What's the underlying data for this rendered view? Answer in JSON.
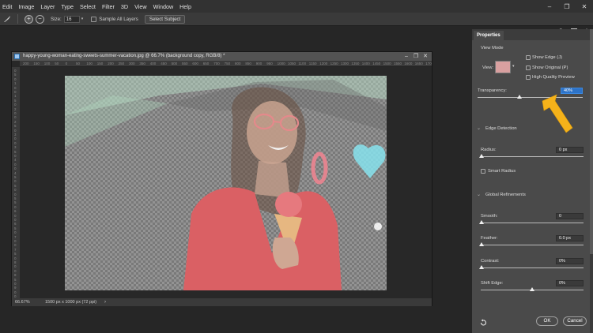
{
  "menu": [
    "Edit",
    "Image",
    "Layer",
    "Type",
    "Select",
    "Filter",
    "3D",
    "View",
    "Window",
    "Help"
  ],
  "window_controls": [
    "–",
    "❐",
    "✕"
  ],
  "options_bar": {
    "size_label": "Size:",
    "size_value": "16",
    "sample_all_layers_label": "Sample All Layers",
    "select_subject_label": "Select Subject"
  },
  "document": {
    "title": "happy-young-woman-eating-sweets-summer-vacation.jpg @ 66.7% (background copy, RGB/8) *",
    "ruler_top": [
      "200",
      "150",
      "100",
      "50",
      "0",
      "50",
      "100",
      "150",
      "200",
      "250",
      "300",
      "350",
      "400",
      "450",
      "500",
      "550",
      "600",
      "650",
      "700",
      "750",
      "800",
      "850",
      "900",
      "950",
      "1000",
      "1050",
      "1100",
      "1150",
      "1200",
      "1250",
      "1300",
      "1350",
      "1400",
      "1450",
      "1500",
      "1550",
      "1600",
      "1650",
      "1700"
    ],
    "ruler_left": [
      "0",
      "5",
      "0",
      "1",
      "0",
      "0",
      "1",
      "5",
      "0",
      "2",
      "0",
      "0",
      "2",
      "5",
      "0",
      "3",
      "0",
      "0",
      "3",
      "5",
      "0",
      "4",
      "0",
      "0",
      "4",
      "5",
      "0",
      "5",
      "0",
      "0",
      "5",
      "5",
      "0",
      "6",
      "0",
      "0",
      "6",
      "5",
      "0",
      "7",
      "0",
      "0",
      "7",
      "5",
      "0",
      "8",
      "0",
      "0",
      "8",
      "5",
      "0",
      "9",
      "0",
      "0"
    ],
    "zoom": "66.67%",
    "doc_info": "1500 px x 1000 px (72 ppi)"
  },
  "properties": {
    "tab_label": "Properties",
    "view_mode_label": "View Mode",
    "view_label": "View:",
    "show_edge_label": "Show Edge (J)",
    "show_original_label": "Show Original (P)",
    "high_quality_preview_label": "High Quality Preview",
    "transparency_label": "Transparency:",
    "transparency_value": "40%",
    "transparency_level": 0.4,
    "edge_detection_label": "Edge Detection",
    "radius_label": "Radius:",
    "radius_value": "0 px",
    "smart_radius_label": "Smart Radius",
    "global_refinements_label": "Global Refinements",
    "smooth_label": "Smooth:",
    "smooth_value": "0",
    "feather_label": "Feather:",
    "feather_value": "0.0 px",
    "contrast_label": "Contrast:",
    "contrast_value": "0%",
    "shift_edge_label": "Shift Edge:",
    "shift_edge_value": "0%",
    "ok_label": "OK",
    "cancel_label": "Cancel"
  },
  "colors": {
    "arrow": "#f5b21a",
    "highlight": "#2d73c8"
  }
}
